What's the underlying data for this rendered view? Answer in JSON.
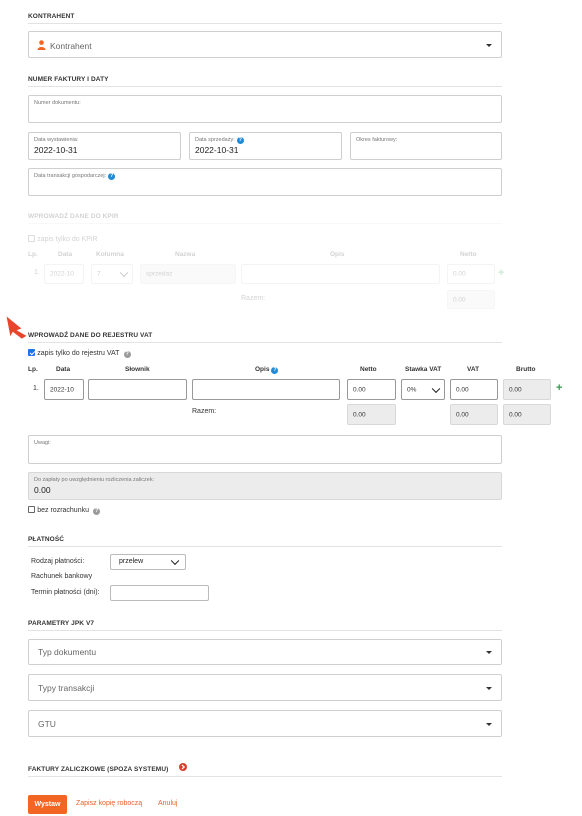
{
  "kontrahent": {
    "section_title": "KONTRAHENT",
    "placeholder": "Kontrahent"
  },
  "numer": {
    "section_title": "NUMER FAKTURY I DATY",
    "doc_number_label": "Numer dokumentu:",
    "issue_date_label": "Data wystawienia:",
    "issue_date_value": "2022-10-31",
    "sale_date_label": "Data sprzedaży:",
    "sale_date_value": "2022-10-31",
    "billing_period_label": "Okres fakturowy:",
    "transaction_date_label": "Data transakcji gospodarczej:"
  },
  "kpir": {
    "section_title": "WPROWADŹ DANE DO KPIR",
    "only_kpir_label": "zapis tylko do KPiR",
    "headers": [
      "Lp.",
      "Data",
      "Kolumna",
      "Nazwa",
      "Opis",
      "Netto"
    ],
    "row": {
      "lp": "1.",
      "date": "2022-10",
      "column": "7",
      "name": "sprzedaż",
      "net": "0.00"
    },
    "sum_label": "Razem:",
    "sum_net": "0.00"
  },
  "vat": {
    "section_title": "WPROWADŹ DANE DO REJESTRU VAT",
    "only_vat_label": "zapis tylko do rejestru VAT",
    "headers": [
      "Lp.",
      "Data",
      "Słownik",
      "Opis",
      "Netto",
      "Stawka VAT",
      "VAT",
      "Brutto"
    ],
    "row": {
      "lp": "1.",
      "date": "2022-10",
      "net": "0.00",
      "rate": "0%",
      "vat": "0.00",
      "gross": "0.00"
    },
    "sum_label": "Razem:",
    "sum_net": "0.00",
    "sum_vat": "0.00",
    "sum_gross": "0.00"
  },
  "remarks": {
    "label": "Uwagi:",
    "to_pay_label": "Do zapłaty po uwzględnieniu rozliczenia zaliczek:",
    "to_pay_value": "0.00",
    "no_settlement_label": "bez rozrachunku"
  },
  "payment": {
    "section_title": "PŁATNOŚĆ",
    "type_label": "Rodzaj płatności:",
    "type_value": "przelew",
    "bank_account_label": "Rachunek bankowy",
    "term_label": "Termin płatności (dni):"
  },
  "jpk": {
    "section_title": "PARAMETRY JPK V7",
    "doc_type_placeholder": "Typ dokumentu",
    "transaction_types_placeholder": "Typy transakcji",
    "gtu_placeholder": "GTU"
  },
  "advance": {
    "section_title": "FAKTURY ZALICZKOWE (SPOZA SYSTEMU)"
  },
  "actions": {
    "issue_label": "Wystaw",
    "save_draft_label": "Zapisz kopię roboczą",
    "cancel_label": "Anuluj"
  },
  "colors": {
    "accent_orange": "#f26522",
    "help_blue": "#1f8ad6",
    "add_green": "#2f9e44",
    "pointer_red": "#e8452c"
  }
}
